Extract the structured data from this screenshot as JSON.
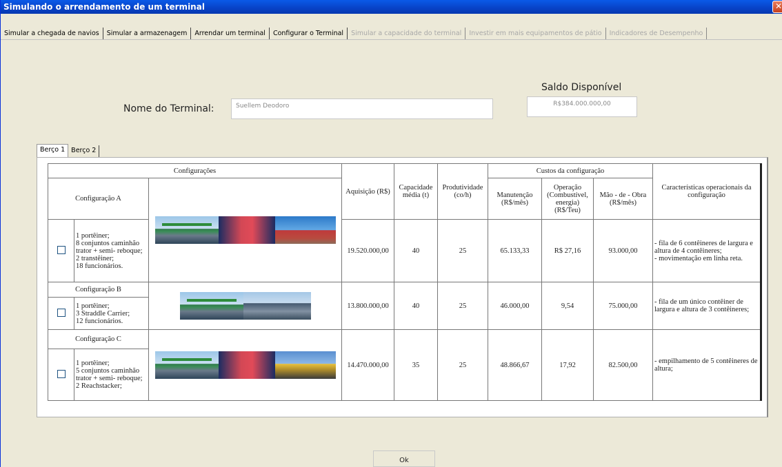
{
  "window": {
    "title": "Simulando o arrendamento de um terminal",
    "close_label": "✕"
  },
  "tabs": [
    {
      "label": "Simular a chegada de navios",
      "state": "normal"
    },
    {
      "label": "Simular a armazenagem",
      "state": "normal"
    },
    {
      "label": "Arrendar um terminal",
      "state": "normal"
    },
    {
      "label": "Configurar o Terminal",
      "state": "active"
    },
    {
      "label": "Simular a capacidade do terminal",
      "state": "disabled"
    },
    {
      "label": "Investir em mais equipamentos de pátio",
      "state": "disabled"
    },
    {
      "label": "Indicadores de Desempenho",
      "state": "disabled"
    }
  ],
  "form": {
    "nome_label": "Nome do Terminal:",
    "nome_value": "Suellem Deodoro",
    "saldo_label": "Saldo Disponível",
    "saldo_value": "R$384.000.000,00"
  },
  "berco_tabs": [
    "Berço 1",
    "Berço 2"
  ],
  "table": {
    "headers": {
      "configuracoes": "Configurações",
      "aquisicao": "Aquisição (R$)",
      "capacidade": "Capacidade média (t)",
      "produtividade": "Produtividade (co/h)",
      "custos": "Custos da configuração",
      "manutencao": "Manutenção (R$/mês)",
      "operacao": "Operação (Combustível, energia) (R$/Teu)",
      "mao_obra": "Mão - de - Obra (R$/mês)",
      "caracteristicas": "Características operacionais da configuração"
    },
    "configs": [
      {
        "name": "Configuração A",
        "equipment": [
          "1 portêiner;",
          "8 conjuntos caminhão trator + semi- reboque;",
          "2 transtêiner;",
          "18 funcionários."
        ],
        "aquisicao": "19.520.000,00",
        "capacidade": "40",
        "produtividade": "25",
        "manutencao": "65.133,33",
        "operacao": "R$ 27,16",
        "mao_obra": "93.000,00",
        "caracteristicas": [
          "- fila de 6 contêineres de largura e altura de 4 contêineres;",
          "- movimentação em linha reta."
        ]
      },
      {
        "name": "Configuração B",
        "equipment": [
          "1 portêiner;",
          "3 Straddle Carrier;",
          "12 funcionários."
        ],
        "aquisicao": "13.800.000,00",
        "capacidade": "40",
        "produtividade": "25",
        "manutencao": "46.000,00",
        "operacao": "9,54",
        "mao_obra": "75.000,00",
        "caracteristicas": [
          "- fila de um único contêiner de largura e altura de 3 contêineres;"
        ]
      },
      {
        "name": "Configuração C",
        "equipment": [
          "1 portêiner;",
          "5 conjuntos caminhão trator + semi- reboque;",
          "2 Reachstacker;"
        ],
        "aquisicao": "14.470.000,00",
        "capacidade": "35",
        "produtividade": "25",
        "manutencao": "48.866,67",
        "operacao": "17,92",
        "mao_obra": "82.500,00",
        "caracteristicas": [
          "- empilhamento de 5 contêineres de altura;"
        ]
      }
    ]
  },
  "ok_label": "Ok"
}
